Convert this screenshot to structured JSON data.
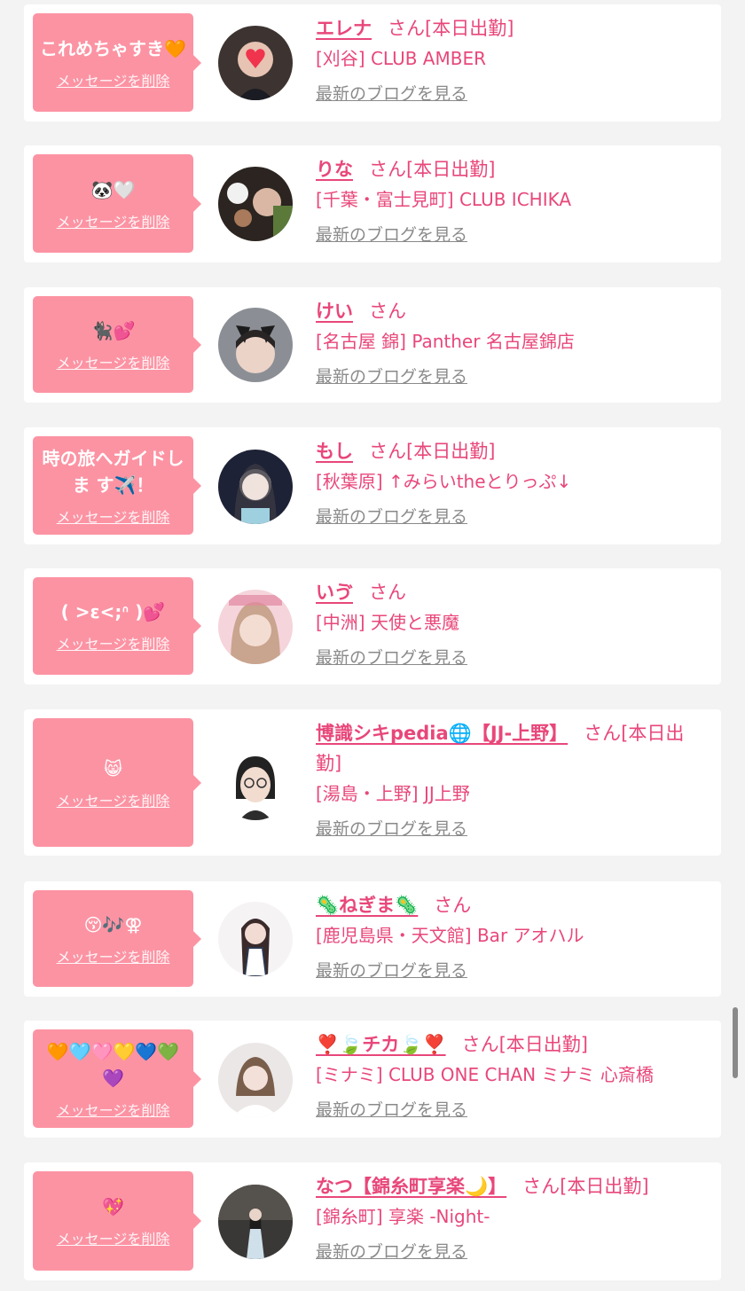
{
  "messages": [
    {
      "message": "これめちゃすき🧡",
      "delete_label": "メッセージを削除",
      "name": "エレナ",
      "honorific": "さん[本日出勤]",
      "shop": "[刈谷] CLUB AMBER",
      "blog_label": "最新のブログを見る"
    },
    {
      "message": "🐼🤍",
      "delete_label": "メッセージを削除",
      "name": "りな",
      "honorific": "さん[本日出勤]",
      "shop": "[千葉・富士見町] CLUB ICHIKA",
      "blog_label": "最新のブログを見る"
    },
    {
      "message": "🐈‍⬛💕",
      "delete_label": "メッセージを削除",
      "name": "けい",
      "honorific": "さん",
      "shop": "[名古屋 錦] Panther 名古屋錦店",
      "blog_label": "最新のブログを見る"
    },
    {
      "message": "時の旅へガイドしま す✈️！",
      "delete_label": "メッセージを削除",
      "name": "もし",
      "honorific": "さん[本日出勤]",
      "shop": "[秋葉原] ↑みらいtheとりっぷ↓",
      "blog_label": "最新のブログを見る"
    },
    {
      "message": "( >ε<;ᐢ )💕",
      "delete_label": "メッセージを削除",
      "name": "いゔ",
      "honorific": "さん",
      "shop": "[中洲] 天使と悪魔",
      "blog_label": "最新のブログを見る"
    },
    {
      "message": "😸",
      "delete_label": "メッセージを削除",
      "name": "博識シキpedia🌐【JJ-上野】",
      "honorific": "さん[本日出勤]",
      "shop": "[湯島・上野] JJ上野",
      "blog_label": "最新のブログを見る"
    },
    {
      "message": "😚🎶⚢",
      "delete_label": "メッセージを削除",
      "name": "🦠ねぎま🦠",
      "honorific": "さん",
      "shop": "[鹿児島県・天文館] Bar アオハル",
      "blog_label": "最新のブログを見る"
    },
    {
      "message": "🧡🩵🩷💛💙💚💜",
      "delete_label": "メッセージを削除",
      "name": "❣️🍃チカ🍃❣️",
      "honorific": "さん[本日出勤]",
      "shop": "[ミナミ] CLUB ONE CHAN ミナミ 心斎橋",
      "blog_label": "最新のブログを見る"
    },
    {
      "message": "💖",
      "delete_label": "メッセージを削除",
      "name": "なつ【錦糸町享楽🌙】",
      "honorific": "さん[本日出勤]",
      "shop": "[錦糸町] 享楽 -Night-",
      "blog_label": "最新のブログを見る"
    }
  ]
}
